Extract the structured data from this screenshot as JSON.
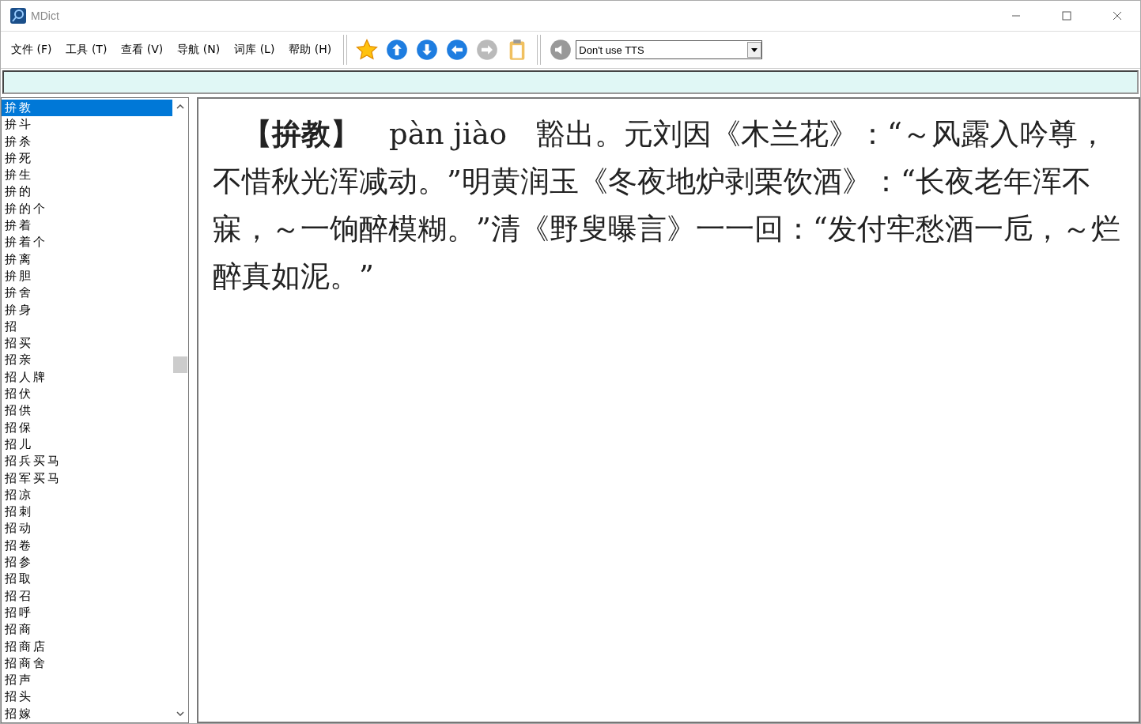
{
  "window": {
    "title": "MDict"
  },
  "menu": [
    "文件 (F)",
    "工具 (T)",
    "查看 (V)",
    "导航 (N)",
    "词库 (L)",
    "帮助 (H)"
  ],
  "toolbar": [
    {
      "kind": "star",
      "disabled": false
    },
    {
      "kind": "up",
      "disabled": false
    },
    {
      "kind": "down",
      "disabled": false
    },
    {
      "kind": "back",
      "disabled": false
    },
    {
      "kind": "forward",
      "disabled": true
    },
    {
      "kind": "clipboard",
      "disabled": false
    }
  ],
  "tts": {
    "value": "Don't use TTS"
  },
  "word_list": [
    {
      "label": "拚教",
      "selected": true
    },
    {
      "label": "拚斗",
      "selected": false
    },
    {
      "label": "拚杀",
      "selected": false
    },
    {
      "label": "拚死",
      "selected": false
    },
    {
      "label": "拚生",
      "selected": false
    },
    {
      "label": "拚的",
      "selected": false
    },
    {
      "label": "拚的个",
      "selected": false
    },
    {
      "label": "拚着",
      "selected": false
    },
    {
      "label": "拚着个",
      "selected": false
    },
    {
      "label": "拚离",
      "selected": false
    },
    {
      "label": "拚胆",
      "selected": false
    },
    {
      "label": "拚舍",
      "selected": false
    },
    {
      "label": "拚身",
      "selected": false
    },
    {
      "label": "招",
      "selected": false
    },
    {
      "label": "招买",
      "selected": false
    },
    {
      "label": "招亲",
      "selected": false
    },
    {
      "label": "招人牌",
      "selected": false
    },
    {
      "label": "招伏",
      "selected": false
    },
    {
      "label": "招供",
      "selected": false
    },
    {
      "label": "招保",
      "selected": false
    },
    {
      "label": "招儿",
      "selected": false
    },
    {
      "label": "招兵买马",
      "selected": false
    },
    {
      "label": "招军买马",
      "selected": false
    },
    {
      "label": "招凉",
      "selected": false
    },
    {
      "label": "招刺",
      "selected": false
    },
    {
      "label": "招动",
      "selected": false
    },
    {
      "label": "招卷",
      "selected": false
    },
    {
      "label": "招参",
      "selected": false
    },
    {
      "label": "招取",
      "selected": false
    },
    {
      "label": "招召",
      "selected": false
    },
    {
      "label": "招呼",
      "selected": false
    },
    {
      "label": "招商",
      "selected": false
    },
    {
      "label": "招商店",
      "selected": false
    },
    {
      "label": "招商舍",
      "selected": false
    },
    {
      "label": "招声",
      "selected": false
    },
    {
      "label": "招头",
      "selected": false
    },
    {
      "label": "招嫁",
      "selected": false
    }
  ],
  "entry": {
    "text": "**【拚教】**　pàn jiào　豁出。元刘因《木兰花》：“～风露入吟尊，不惜秋光浑减动。”明黄润玉《冬夜地炉剥栗饮酒》：“长夜老年浑不寐，～一饷醉模糊。”清《野叟曝言》一一回：“发付牢愁酒一卮，～烂醉真如泥。”"
  }
}
